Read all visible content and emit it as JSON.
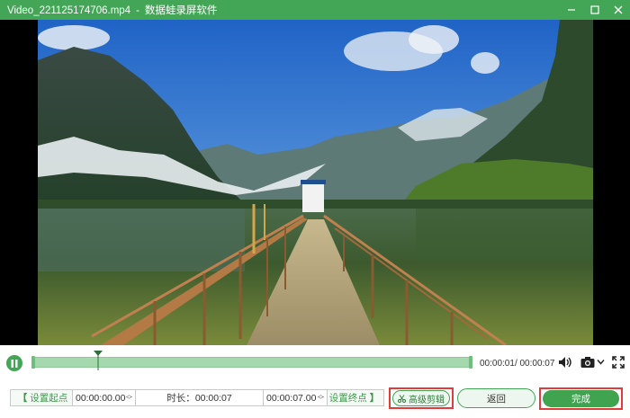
{
  "window": {
    "file_name": "Video_221125174706.mp4",
    "separator": "-",
    "app_name": "数据蛙录屏软件",
    "buttons": [
      "minimize-icon",
      "maximize-icon",
      "close-icon"
    ]
  },
  "player": {
    "state_icon": "pause-icon",
    "current_time": "00:00:01",
    "total_time": "/ 00:00:07",
    "progress_fraction": 0.15,
    "icons": [
      "volume-icon",
      "camera-icon",
      "chevron-down-icon",
      "fullscreen-icon"
    ]
  },
  "trim": {
    "set_start_label": "设置起点",
    "start_value": "00:00:00.00",
    "duration_label": "时长：",
    "duration_value": "00:00:07",
    "end_value": "00:00:07.00",
    "set_end_label": "设置终点",
    "bracket_left": "【",
    "bracket_right": "】"
  },
  "actions": {
    "advanced_edit_label": "高级剪辑",
    "back_label": "返回",
    "done_label": "完成"
  },
  "colors": {
    "brand_green": "#43a556",
    "highlight_red": "#e23b3b",
    "track_fill": "#a6d8ad"
  }
}
